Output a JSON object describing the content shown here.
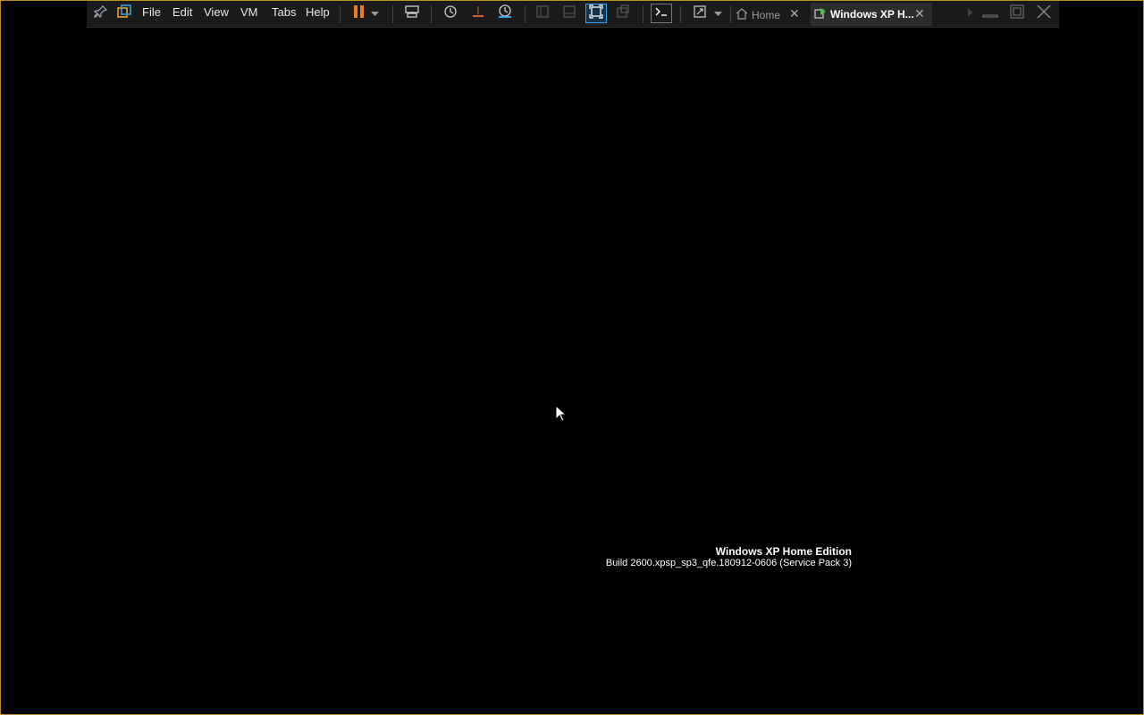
{
  "menu": {
    "file": "File",
    "edit": "Edit",
    "view": "View",
    "vm": "VM",
    "tabs": "Tabs",
    "help": "Help"
  },
  "tabs": [
    {
      "label": "Home",
      "icon": "home-icon"
    },
    {
      "label": "Windows XP H...",
      "icon": "vm-running-icon"
    }
  ],
  "boot": {
    "title": "Windows XP Home Edition",
    "build": "Build 2600.xpsp_sp3_qfe.180912-0606 (Service Pack 3)"
  },
  "colors": {
    "frame_border": "#b8941e",
    "toolbar_bg": "#1b1b1b",
    "pause_orange": "#f07a1e",
    "accent_blue": "#3ca0e6",
    "accent_green": "#4fc24f"
  }
}
